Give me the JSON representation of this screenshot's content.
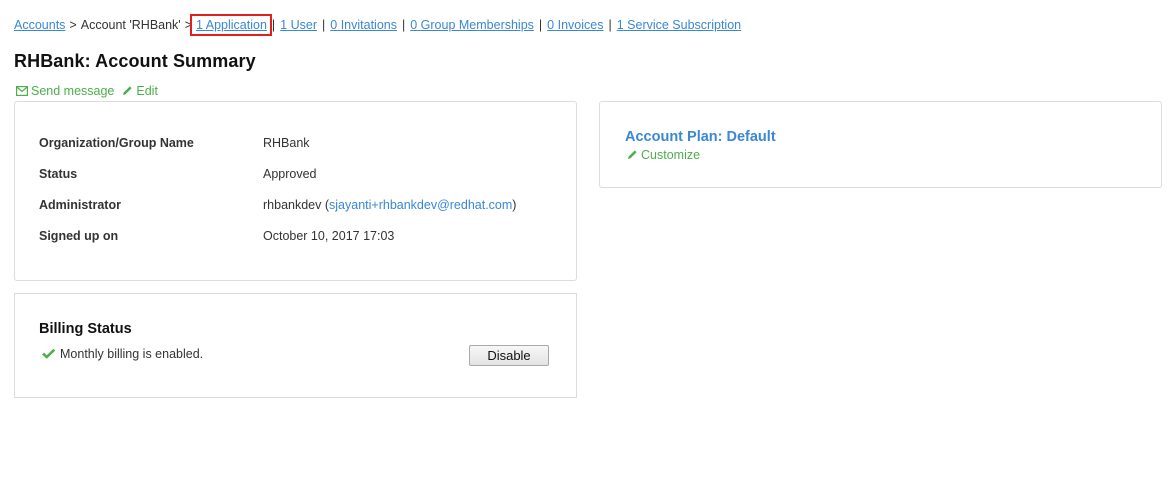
{
  "breadcrumb": {
    "accounts_link": "Accounts",
    "separator": ">",
    "current": "Account 'RHBank'",
    "links": [
      {
        "count": "1",
        "label": "Application",
        "highlighted": true
      },
      {
        "count": "1",
        "label": "User"
      },
      {
        "count": "0",
        "label": "Invitations"
      },
      {
        "count": "0",
        "label": "Group Memberships"
      },
      {
        "count": "0",
        "label": "Invoices"
      },
      {
        "count": "1",
        "label": "Service Subscription"
      }
    ]
  },
  "page": {
    "title": "RHBank: Account Summary",
    "send_message_label": "Send message",
    "edit_label": "Edit"
  },
  "summary": {
    "fields": [
      {
        "label": "Organization/Group Name",
        "value": "RHBank"
      },
      {
        "label": "Status",
        "value": "Approved"
      },
      {
        "label": "Administrator",
        "value": "rhbankdev",
        "email": "sjayanti+rhbankdev@redhat.com"
      },
      {
        "label": "Signed up on",
        "value": "October 10, 2017 17:03"
      }
    ]
  },
  "billing": {
    "title": "Billing Status",
    "status_text": "Monthly billing is enabled.",
    "disable_label": "Disable"
  },
  "plan": {
    "title": "Account Plan: Default",
    "customize_label": "Customize"
  },
  "icons": {
    "send_message": "envelope-icon",
    "edit": "pencil-icon",
    "customize": "pencil-icon",
    "billing_ok": "checkmark-icon"
  },
  "colors": {
    "link": "#3a87d6",
    "action_green": "#4cae4c",
    "highlight_box": "#e11f1f"
  }
}
